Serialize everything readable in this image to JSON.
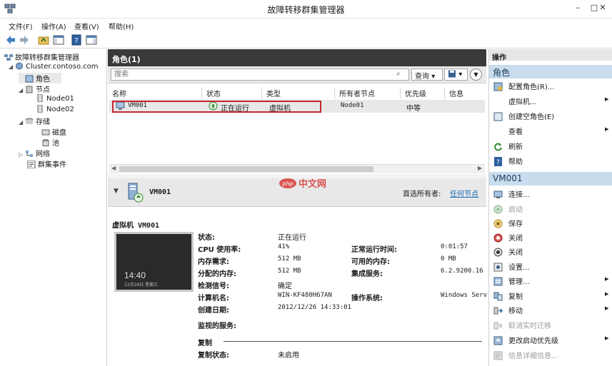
{
  "window": {
    "title": "故障转移群集管理器",
    "minimize": "–",
    "maximize": "□",
    "close": "✕"
  },
  "menu": [
    "文件(F)",
    "操作(A)",
    "查看(V)",
    "帮助(H)"
  ],
  "tree": {
    "root": "故障转移群集管理器",
    "cluster": "Cluster.contoso.com",
    "roles": "角色",
    "nodes": "节点",
    "node1": "Node01",
    "node2": "Node02",
    "storage": "存储",
    "disks": "磁盘",
    "pools": "池",
    "networks": "网络",
    "events": "群集事件"
  },
  "center": {
    "header": "角色(1)",
    "search_placeholder": "搜索",
    "query_label": "查询",
    "columns": [
      "名称",
      "状态",
      "类型",
      "所有者节点",
      "优先级",
      "信息"
    ],
    "row": {
      "name": "VM001",
      "status": "正在运行",
      "type": "虚拟机",
      "owner": "Node01",
      "priority": "中等",
      "info": ""
    }
  },
  "detail": {
    "title": "VM001",
    "preferred_owner_label": "首选所有者:",
    "preferred_owner_value": "任何节点",
    "section": "虚拟机 VM001",
    "thumb_time": "14:40",
    "thumb_date": "12月26日 星期三",
    "props_left": [
      {
        "k": "状态:",
        "v": "正在运行"
      },
      {
        "k": "CPU 使用率:",
        "v": "41%"
      },
      {
        "k": "内存需求:",
        "v": "512 MB"
      },
      {
        "k": "分配的内存:",
        "v": "512 MB"
      },
      {
        "k": "检测信号:",
        "v": "确定"
      },
      {
        "k": "计算机名:",
        "v": "WIN-KF480H67AN"
      },
      {
        "k": "创建日期:",
        "v": "2012/12/26 14:33:01"
      },
      {
        "k": "监视的服务:",
        "v": ""
      }
    ],
    "props_right": [
      {
        "k": "正常运行时间:",
        "v": "0:01:57"
      },
      {
        "k": "可用的内存:",
        "v": "0 MB"
      },
      {
        "k": "集成服务:",
        "v": "6.2.9200.16"
      },
      {
        "k": "操作系统:",
        "v": "Windows Serv"
      }
    ],
    "replication": "复制",
    "replication_status_label": "复制状态:",
    "replication_status_value": "未启用"
  },
  "actions": {
    "title": "操作",
    "section1": "角色",
    "items1": [
      "配置角色(R)...",
      "虚拟机...",
      "创建空角色(E)",
      "查看",
      "刷新",
      "帮助"
    ],
    "section2": "VM001",
    "items2": [
      "连接...",
      "启动",
      "保存",
      "关闭",
      "关闭",
      "设置...",
      "管理...",
      "复制",
      "移动",
      "取消实时迁移",
      "更改启动优先级",
      "信息详细信息..."
    ]
  },
  "watermark": "php中文网",
  "colors": {
    "accent_blue": "#c8dcee",
    "header_dark": "#3a3a3a",
    "highlight_red": "#c1272d",
    "link": "#1a6bb5"
  }
}
